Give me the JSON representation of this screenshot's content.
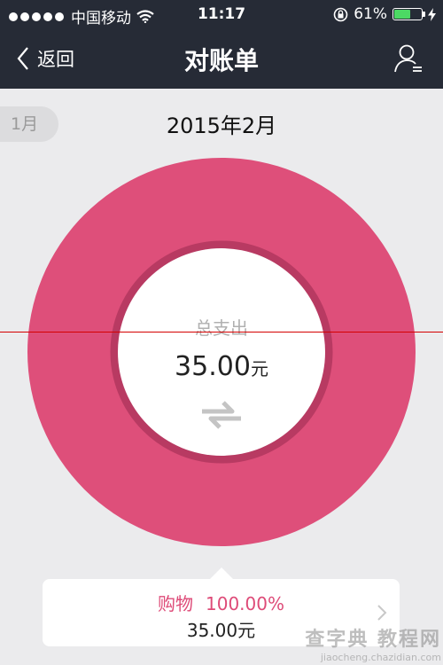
{
  "status_bar": {
    "carrier": "中国移动",
    "time": "11:17",
    "battery_percent": "61%",
    "battery_level": 0.61,
    "signal_bars": 5
  },
  "nav": {
    "back_label": "返回",
    "title": "对账单"
  },
  "month_selector": {
    "prev_month": "1月",
    "current": "2015年2月"
  },
  "summary": {
    "label": "总支出",
    "amount": "35.00",
    "unit": "元"
  },
  "category_card": {
    "name": "购物",
    "percent": "100.00%",
    "amount": "35.00元"
  },
  "chart_data": {
    "type": "pie",
    "categories": [
      "购物"
    ],
    "values": [
      100.0
    ],
    "title": "",
    "colors": [
      "#de4f7a"
    ]
  },
  "colors": {
    "header_bg": "#262b36",
    "accent_pink": "#de4f7a",
    "page_bg": "#ebebed"
  },
  "watermark": {
    "line1": "查字典 教程网",
    "line2": "jiaocheng.chazidian.com"
  },
  "icons": [
    "wifi-icon",
    "lock-rotation-icon",
    "battery-icon",
    "charging-icon",
    "back-chevron-icon",
    "user-menu-icon",
    "swap-icon",
    "chevron-right-icon"
  ]
}
